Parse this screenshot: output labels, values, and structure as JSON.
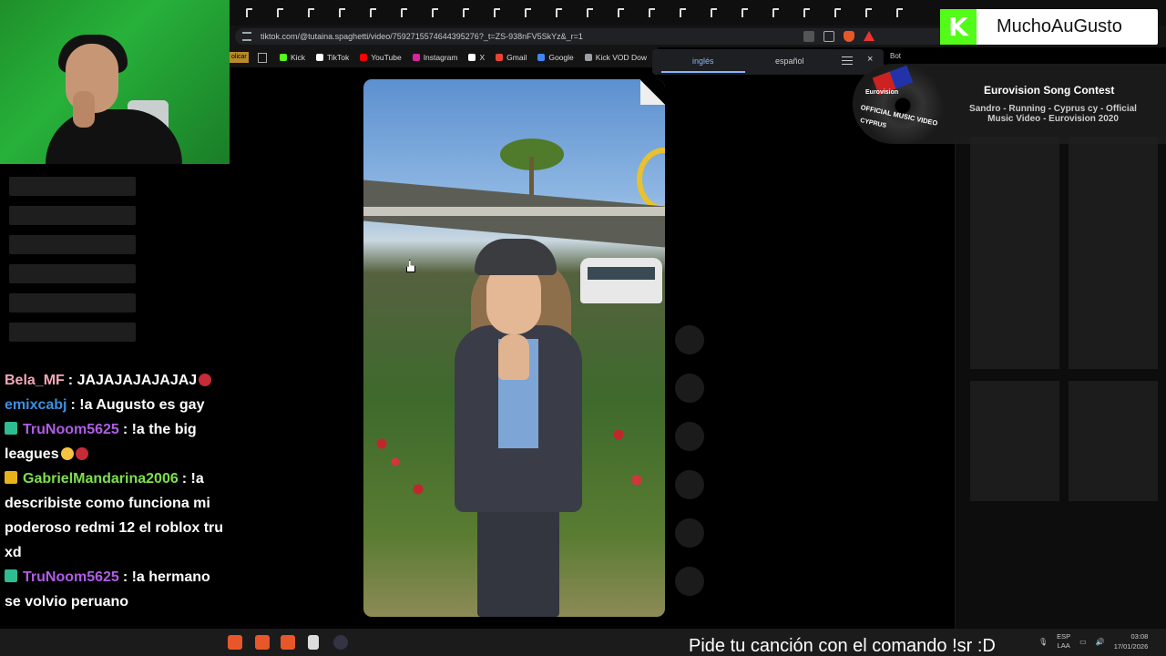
{
  "browser": {
    "url": "tiktok.com/@tutaina.spaghetti/video/7592715574644395276?_t=ZS-938nFV5SkYz&_r=1",
    "bookmark_stub": "olicar",
    "bookmarks": [
      {
        "label": "Kick",
        "icon": "kick-icon",
        "color": "#53fc18"
      },
      {
        "label": "TikTok",
        "icon": "tiktok-icon",
        "color": "#ffffff"
      },
      {
        "label": "YouTube",
        "icon": "youtube-icon",
        "color": "#ff0000"
      },
      {
        "label": "Instagram",
        "icon": "instagram-icon",
        "color": "#d6249f"
      },
      {
        "label": "X",
        "icon": "x-icon",
        "color": "#ffffff"
      },
      {
        "label": "Gmail",
        "icon": "gmail-icon",
        "color": "#ea4335"
      },
      {
        "label": "Google",
        "icon": "google-icon",
        "color": "#4285f4"
      },
      {
        "label": "Kick VOD Dow",
        "icon": "kick-vod-icon",
        "color": "#9aa0a6"
      }
    ],
    "translate": {
      "source": "inglés",
      "target": "español"
    },
    "bot_label": "Bot"
  },
  "overlay": {
    "channel_name": "MuchoAuGusto",
    "kick_letter": "K",
    "now_playing": {
      "title": "Eurovision Song Contest",
      "subtitle": "Sandro - Running - Cyprus cy - Official Music Video - Eurovision 2020",
      "disc_logo": "Eurovision",
      "disc_label": "OFFICIAL MUSIC VIDEO",
      "disc_country": "CYPRUS"
    },
    "request_hint": "Pide tu canción con el comando !sr :D"
  },
  "chat": [
    {
      "user": "Bela_MF",
      "color": "#f0a8b8",
      "text": ": JAJAJAJAJAJAJ",
      "badge": null,
      "emoji": "rose"
    },
    {
      "user": "emixcabj",
      "color": "#3d8fe0",
      "text": ": !a Augusto es gay",
      "badge": null,
      "emoji": null
    },
    {
      "user": "TruNoom5625",
      "color": "#b05ce6",
      "text": ": !a the big leagues",
      "badge": "green",
      "emoji": "scream-rose"
    },
    {
      "user": "GabrielMandarina2006",
      "color": "#7ee04a",
      "text": ": !a describiste como funciona mi poderoso redmi 12 el roblox tru xd",
      "badge": "gold",
      "emoji": null
    },
    {
      "user": "TruNoom5625",
      "color": "#b05ce6",
      "text": ": !a hermano se volvio peruano",
      "badge": "green",
      "emoji": null
    }
  ],
  "taskbar": {
    "lang_top": "ESP",
    "lang_bottom": "LAA",
    "time": "03:08",
    "date": "17/01/2026"
  },
  "colors": {
    "kick_green": "#53fc18",
    "background": "#000000",
    "taskbar": "#1b1b1b"
  }
}
